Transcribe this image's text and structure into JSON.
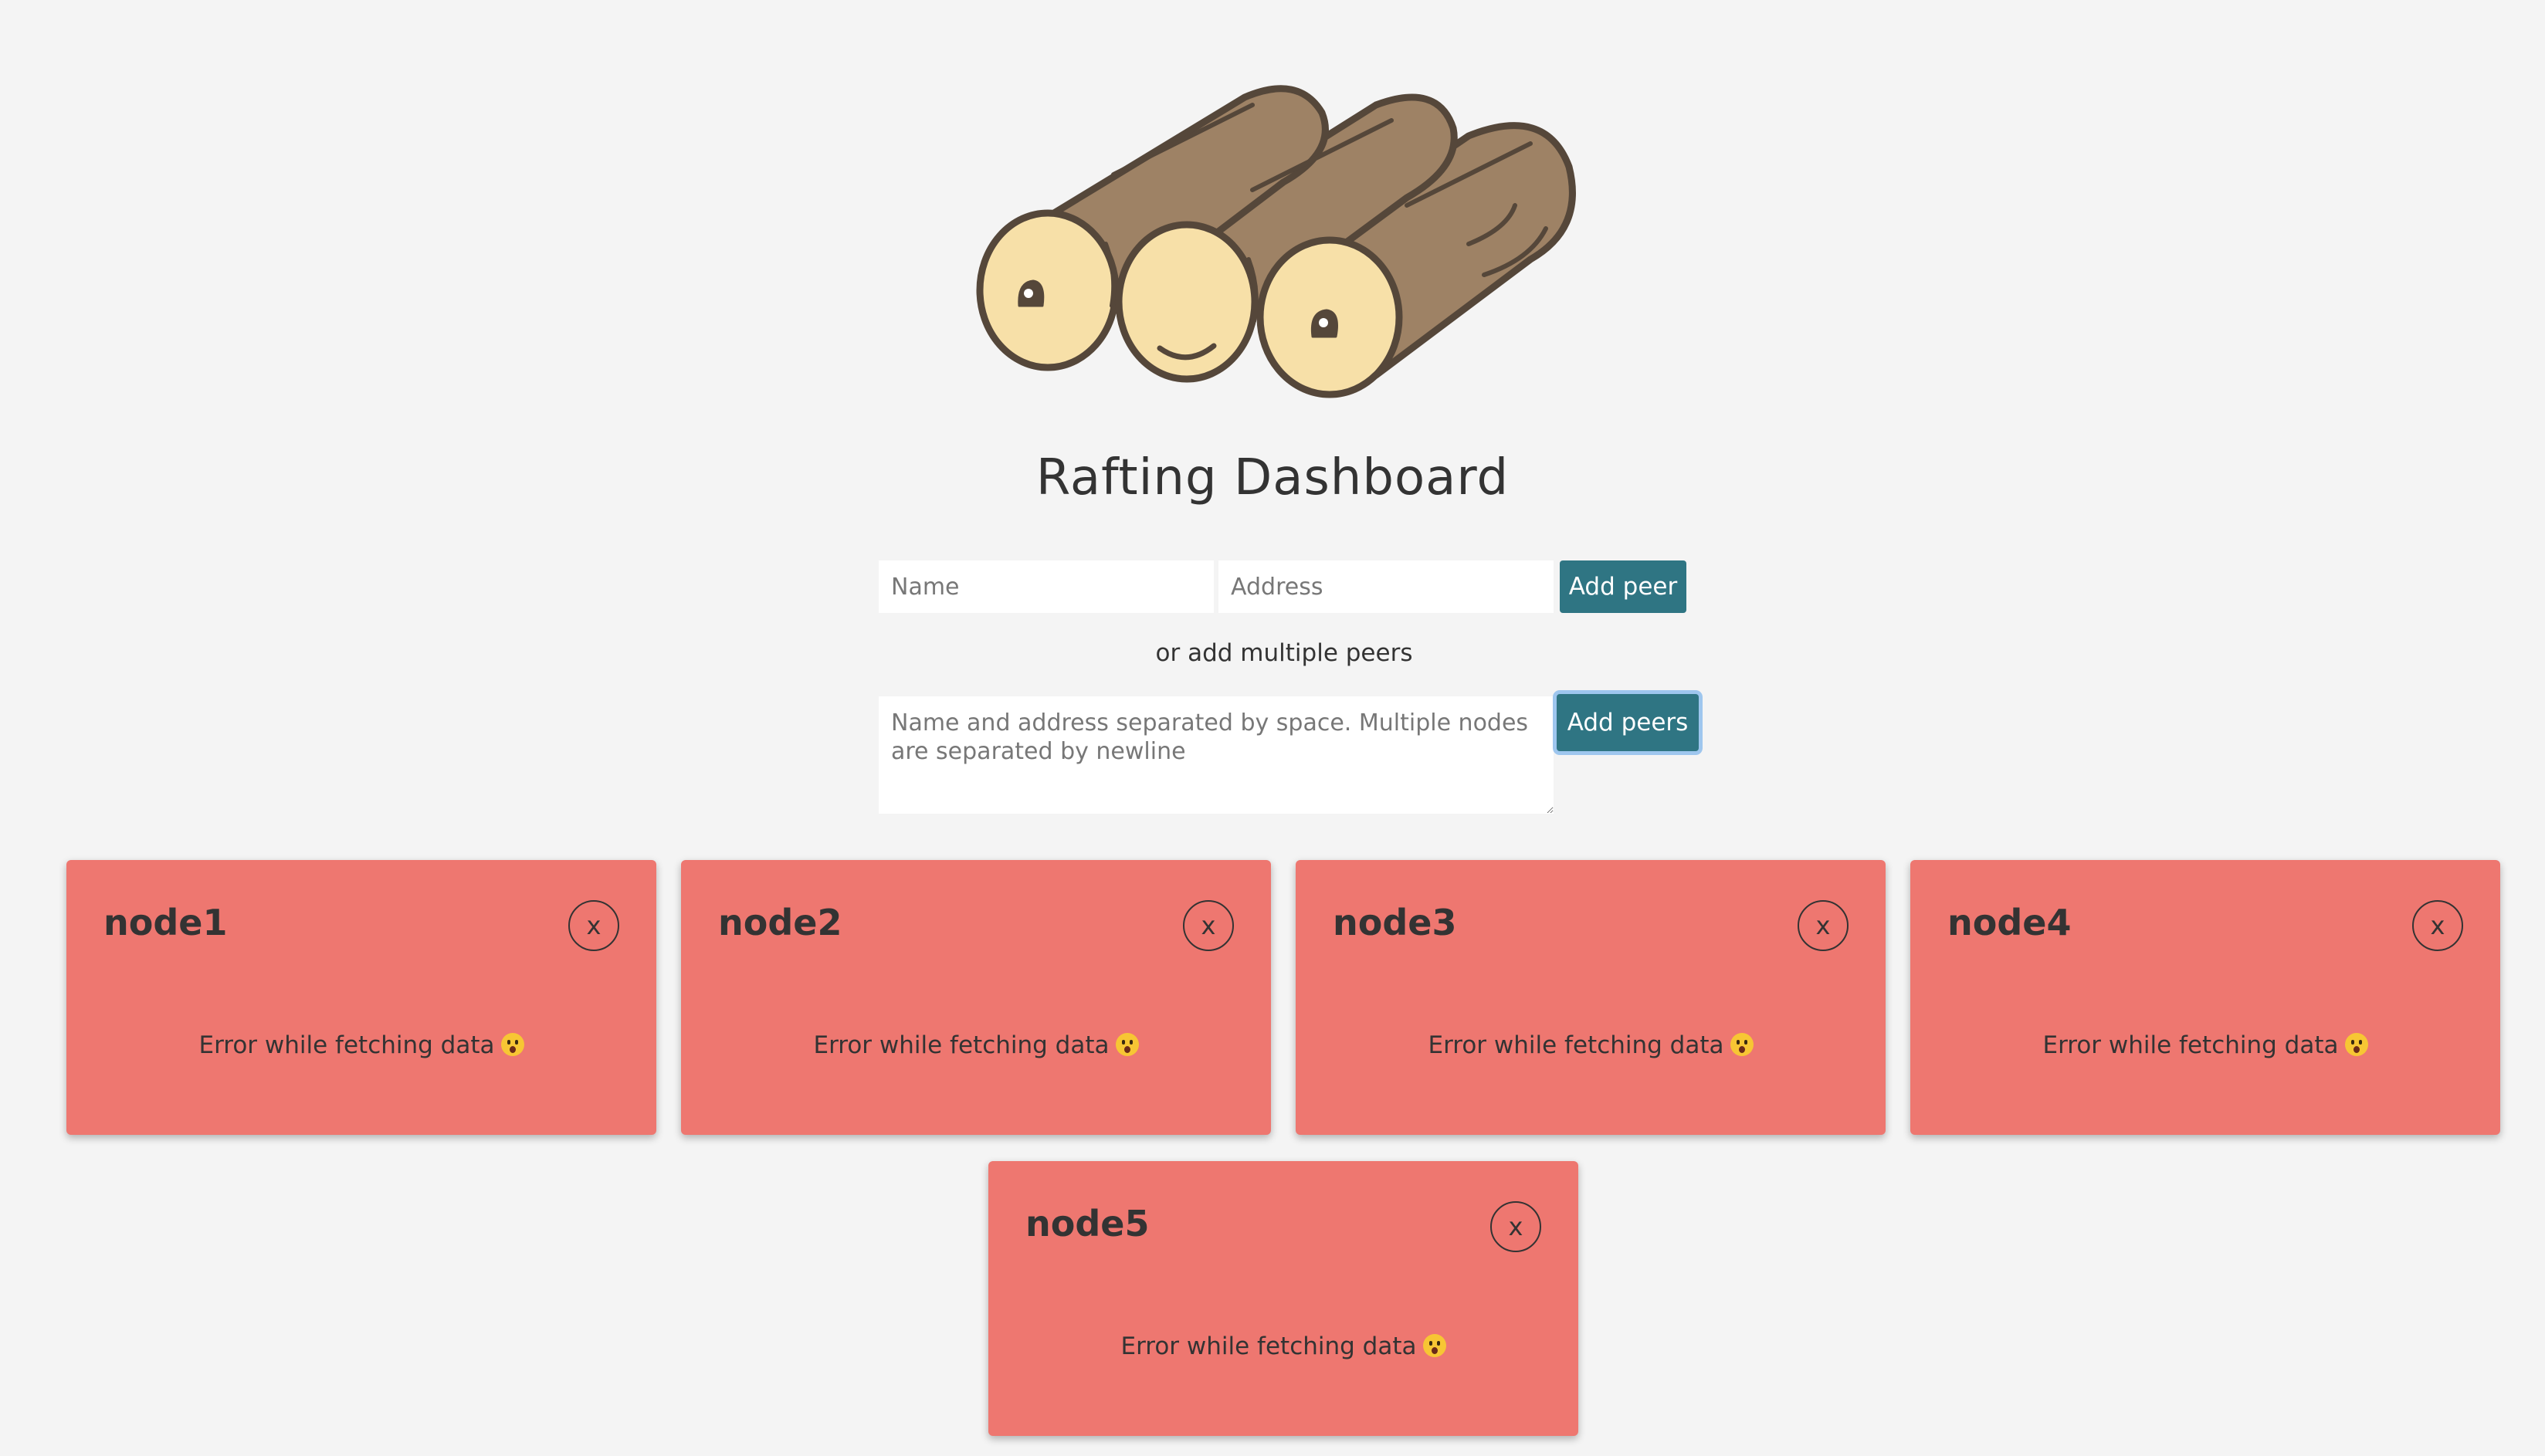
{
  "header": {
    "title": "Rafting Dashboard",
    "logo_icon": "wooden-raft-logs-icon"
  },
  "add_peer_form": {
    "name_placeholder": "Name",
    "address_placeholder": "Address",
    "name_value": "",
    "address_value": "",
    "add_peer_label": "Add peer"
  },
  "multi_peer_form": {
    "divider_text": "or add multiple peers",
    "textarea_placeholder": "Name and address separated by space. Multiple nodes are separated by newline",
    "textarea_value": "",
    "add_peers_label": "Add peers"
  },
  "colors": {
    "background": "#f4f4f4",
    "button": "#2f7583",
    "card_error": "#ee7770",
    "text": "#333333"
  },
  "nodes": [
    {
      "name": "node1",
      "close_label": "x",
      "message": "Error while fetching data",
      "status_icon": "screaming-face-emoji-icon"
    },
    {
      "name": "node2",
      "close_label": "x",
      "message": "Error while fetching data",
      "status_icon": "screaming-face-emoji-icon"
    },
    {
      "name": "node3",
      "close_label": "x",
      "message": "Error while fetching data",
      "status_icon": "screaming-face-emoji-icon"
    },
    {
      "name": "node4",
      "close_label": "x",
      "message": "Error while fetching data",
      "status_icon": "screaming-face-emoji-icon"
    },
    {
      "name": "node5",
      "close_label": "x",
      "message": "Error while fetching data",
      "status_icon": "screaming-face-emoji-icon"
    }
  ]
}
